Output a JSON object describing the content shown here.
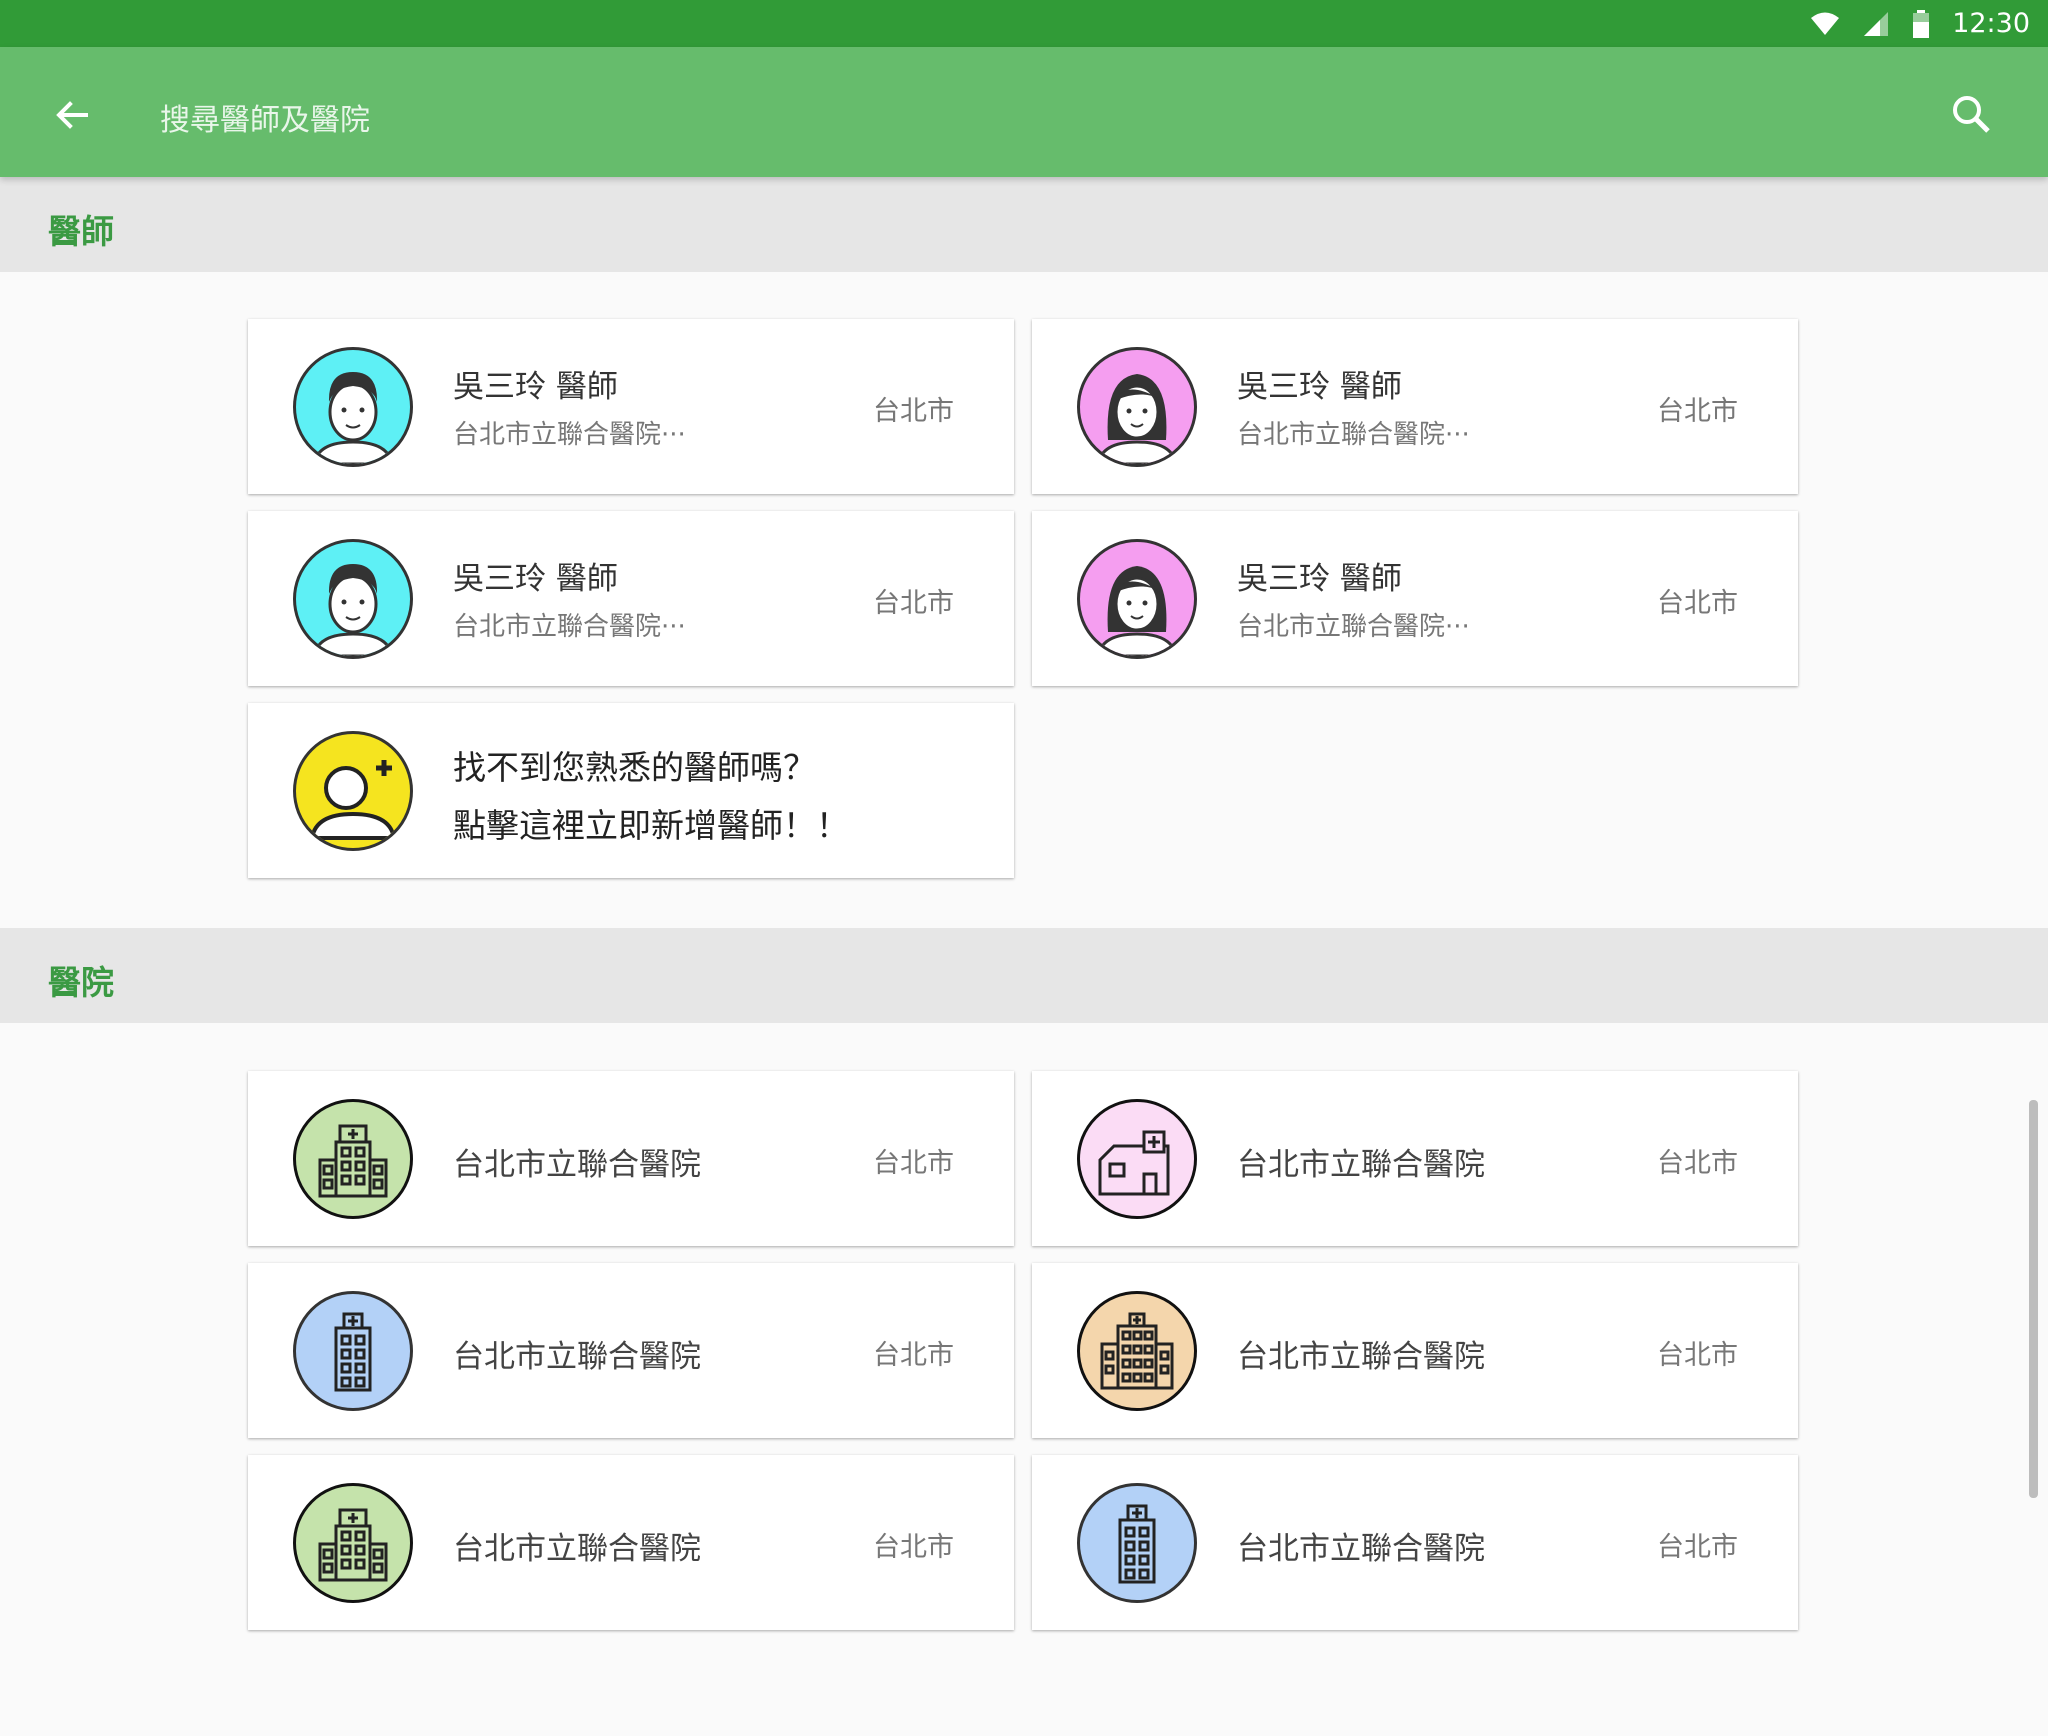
{
  "status_bar": {
    "time": "12:30"
  },
  "app_bar": {
    "title": "搜尋醫師及醫院"
  },
  "sections": {
    "doctors": "醫師",
    "hospitals": "醫院"
  },
  "doctors": [
    {
      "name": "吳三玲 醫師",
      "hospital": "台北市立聯合醫院···",
      "city": "台北市",
      "avatar": "male-doctor-icon"
    },
    {
      "name": "吳三玲 醫師",
      "hospital": "台北市立聯合醫院···",
      "city": "台北市",
      "avatar": "female-doctor-icon"
    },
    {
      "name": "吳三玲 醫師",
      "hospital": "台北市立聯合醫院···",
      "city": "台北市",
      "avatar": "male-doctor-icon"
    },
    {
      "name": "吳三玲 醫師",
      "hospital": "台北市立聯合醫院···",
      "city": "台北市",
      "avatar": "female-doctor-icon"
    }
  ],
  "add_doctor": {
    "line1": "找不到您熟悉的醫師嗎？",
    "line2": "點擊這裡立即新增醫師！！"
  },
  "hospitals": [
    {
      "name": "台北市立聯合醫院",
      "city": "台北市",
      "icon": "hospital-building-icon",
      "color": "#c5e3ab"
    },
    {
      "name": "台北市立聯合醫院",
      "city": "台北市",
      "icon": "clinic-house-icon",
      "color": "#fbdcf5"
    },
    {
      "name": "台北市立聯合醫院",
      "city": "台北市",
      "icon": "hospital-tower-icon",
      "color": "#b3d1f7"
    },
    {
      "name": "台北市立聯合醫院",
      "city": "台北市",
      "icon": "hospital-large-icon",
      "color": "#f4d6ac"
    },
    {
      "name": "台北市立聯合醫院",
      "city": "台北市",
      "icon": "hospital-building-icon",
      "color": "#c5e3ab"
    },
    {
      "name": "台北市立聯合醫院",
      "city": "台北市",
      "icon": "hospital-tower-icon",
      "color": "#b3d1f7"
    }
  ],
  "colors": {
    "status_bar": "#319b37",
    "app_bar": "#66bc6c",
    "section_title": "#3b9a43",
    "male_avatar_bg": "#5ef0f5",
    "female_avatar_bg": "#f59ef0",
    "add_avatar_bg": "#f5e41f"
  }
}
